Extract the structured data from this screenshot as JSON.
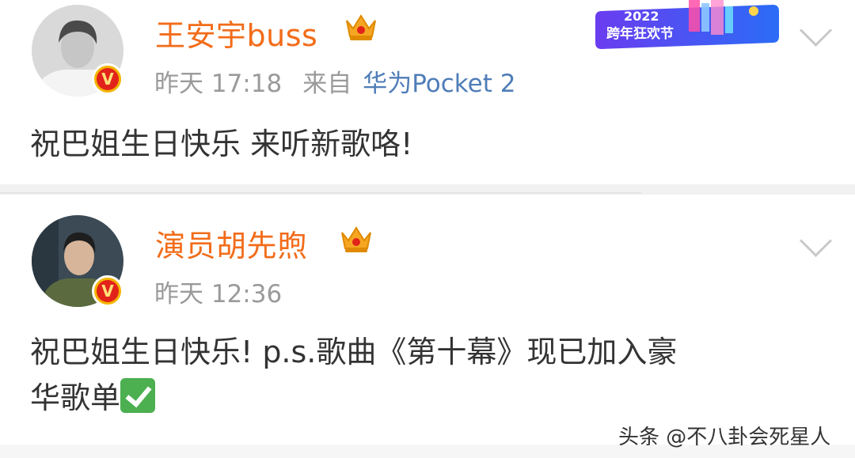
{
  "posts": [
    {
      "username": "王安宇buss",
      "time": "昨天 17:18",
      "source_prefix": "来自",
      "source_device": "华为Pocket 2",
      "content": "祝巴姐生日快乐  来听新歌咯!",
      "badge": "V",
      "crown_icon": "crown-icon",
      "chevron_icon": "chevron-down-icon"
    },
    {
      "username": "演员胡先煦",
      "time": "昨天 12:36",
      "content_line1": "祝巴姐生日快乐! p.s.歌曲《第十幕》现已加入豪",
      "content_line2": "华歌单",
      "badge": "V",
      "crown_icon": "crown-icon",
      "chevron_icon": "chevron-down-icon",
      "emoji_icon": "check-mark-emoji"
    }
  ],
  "promo_banner": {
    "year": "2022",
    "text": "跨年狂欢节"
  },
  "watermark": "头条 @不八卦会死星人",
  "colors": {
    "username": "#f26c1a",
    "meta": "#9a9a9a",
    "device": "#4f7db8",
    "text": "#333333"
  }
}
